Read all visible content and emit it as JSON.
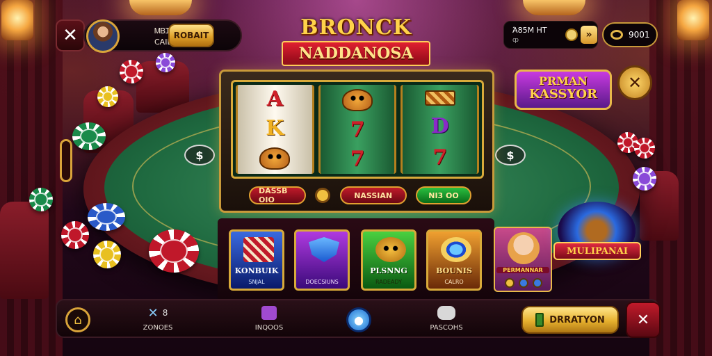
{
  "colors": {
    "gold": "#d9a43a",
    "felt": "#1f6a40",
    "accent_red": "#c01a2a",
    "accent_purple": "#8a2ac8"
  },
  "header": {
    "close_icon": "close-icon",
    "profile_name": "ᎷᏴᏆᎾᏴᏆᏆᏆᏴᎬ",
    "profile_sub": "CAIBAS",
    "profile_button": "ROBAIT",
    "right_pill_label": "Ά85Μ ΗΤ",
    "right_pill_sub": "ȹ",
    "arrow_label": "»",
    "coins": "9001"
  },
  "title": {
    "line1": "BRONCK",
    "line2": "NADDANOSA"
  },
  "slot": {
    "reels": [
      [
        "A",
        "K",
        "face"
      ],
      [
        "face",
        "7",
        "7"
      ],
      [
        "bars",
        "D",
        "7"
      ]
    ],
    "btn_left": "DASSB OIO",
    "btn_mid": "NASSIAN",
    "btn_right": "NI3 OO"
  },
  "tiles": [
    {
      "title": "KONBUIK",
      "sub": "SNJAL",
      "icon": "bars-icon"
    },
    {
      "title": "",
      "sub": "DOECSIUNS",
      "icon": "shield-icon"
    },
    {
      "title": "PLSNNG",
      "sub": "RADEADY",
      "icon": "monkey-icon"
    },
    {
      "title": "BOUNIS",
      "sub": "CALRO",
      "icon": "gem-icon"
    }
  ],
  "promos": {
    "kassy_line1": "PRMAN",
    "kassy_line2": "KASSYOR",
    "card_label": "PERMANNAR",
    "multi_label": "MULIPANAI"
  },
  "nav": {
    "item1_label": "ZONOES",
    "item1_count": "8",
    "item2_label": "INQOOS",
    "item3_label": "PASCOHS",
    "cta_label": "DRRATYON"
  }
}
